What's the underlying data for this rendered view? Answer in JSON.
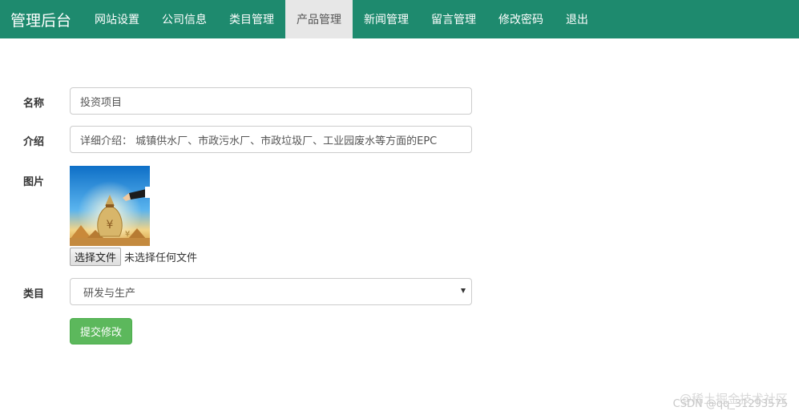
{
  "navbar": {
    "brand": "管理后台",
    "items": [
      {
        "label": "网站设置",
        "active": false
      },
      {
        "label": "公司信息",
        "active": false
      },
      {
        "label": "类目管理",
        "active": false
      },
      {
        "label": "产品管理",
        "active": true
      },
      {
        "label": "新闻管理",
        "active": false
      },
      {
        "label": "留言管理",
        "active": false
      },
      {
        "label": "修改密码",
        "active": false
      },
      {
        "label": "退出",
        "active": false
      }
    ],
    "bg_color": "#1e8a6e",
    "active_bg_color": "#e7e7e7"
  },
  "form": {
    "name": {
      "label": "名称",
      "value": "投资项目"
    },
    "intro": {
      "label": "介绍",
      "value": "详细介绍： 城镇供水厂、市政污水厂、市政垃圾厂、工业园废水等方面的EPC"
    },
    "picture": {
      "label": "图片",
      "file_button": "选择文件",
      "file_status": "未选择任何文件"
    },
    "category": {
      "label": "类目",
      "selected": "研发与生产"
    },
    "submit_label": "提交修改",
    "submit_color": "#5cb85c"
  },
  "watermarks": {
    "line1": "@稀土掘金技术社区",
    "line2": "CSDN @qq_31293575"
  }
}
